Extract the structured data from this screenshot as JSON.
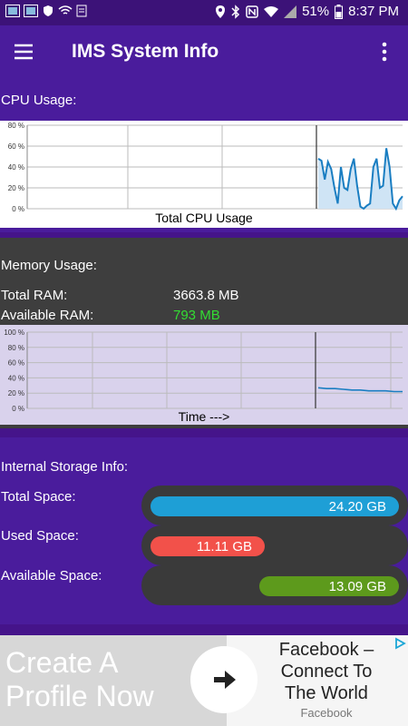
{
  "status_bar": {
    "battery": "51%",
    "time": "8:37 PM"
  },
  "app_bar": {
    "title": "IMS System Info"
  },
  "cpu": {
    "section_label": "CPU Usage:",
    "chart_caption": "Total CPU Usage",
    "y_ticks": [
      "80 %",
      "60 %",
      "40 %",
      "20 %",
      "0 %"
    ]
  },
  "memory": {
    "section_label": "Memory Usage:",
    "total_label": "Total RAM:",
    "total_value": "3663.8 MB",
    "available_label": "Available RAM:",
    "available_value": "793 MB",
    "available_color": "#33dd33",
    "chart_caption": "Time --->",
    "y_ticks": [
      "100 %",
      "80 %",
      "60 %",
      "40 %",
      "20 %",
      "0 %"
    ]
  },
  "storage": {
    "section_label": "Internal Storage Info:",
    "total_label": "Total Space:",
    "total_value": "24.20  GB",
    "total_color": "#1e9fd6",
    "used_label": "Used Space:",
    "used_value": "11.11  GB",
    "used_color": "#f2514a",
    "available_label": "Available Space:",
    "available_value": "13.09  GB",
    "available_color": "#5d9a1c"
  },
  "ad": {
    "headline": "Create A Profile Now",
    "title": "Facebook – Connect To The World",
    "brand": "Facebook"
  },
  "chart_data": [
    {
      "type": "line",
      "title": "Total CPU Usage",
      "ylim": [
        0,
        80
      ],
      "y_ticks": [
        0,
        20,
        40,
        60,
        80
      ],
      "series": [
        {
          "values": [
            48,
            46,
            28,
            45,
            38,
            20,
            5,
            40,
            20,
            18,
            38,
            48,
            22,
            2,
            0,
            3,
            5,
            40,
            48,
            20,
            22,
            58,
            40,
            5,
            0,
            8,
            12
          ]
        }
      ],
      "grid": true
    },
    {
      "type": "line",
      "title": "Time --->",
      "ylim": [
        0,
        100
      ],
      "y_ticks": [
        0,
        20,
        40,
        60,
        80,
        100
      ],
      "series": [
        {
          "values": [
            27,
            26,
            26,
            25,
            24,
            24,
            23,
            23,
            23,
            22,
            22
          ]
        }
      ],
      "grid": true
    }
  ]
}
